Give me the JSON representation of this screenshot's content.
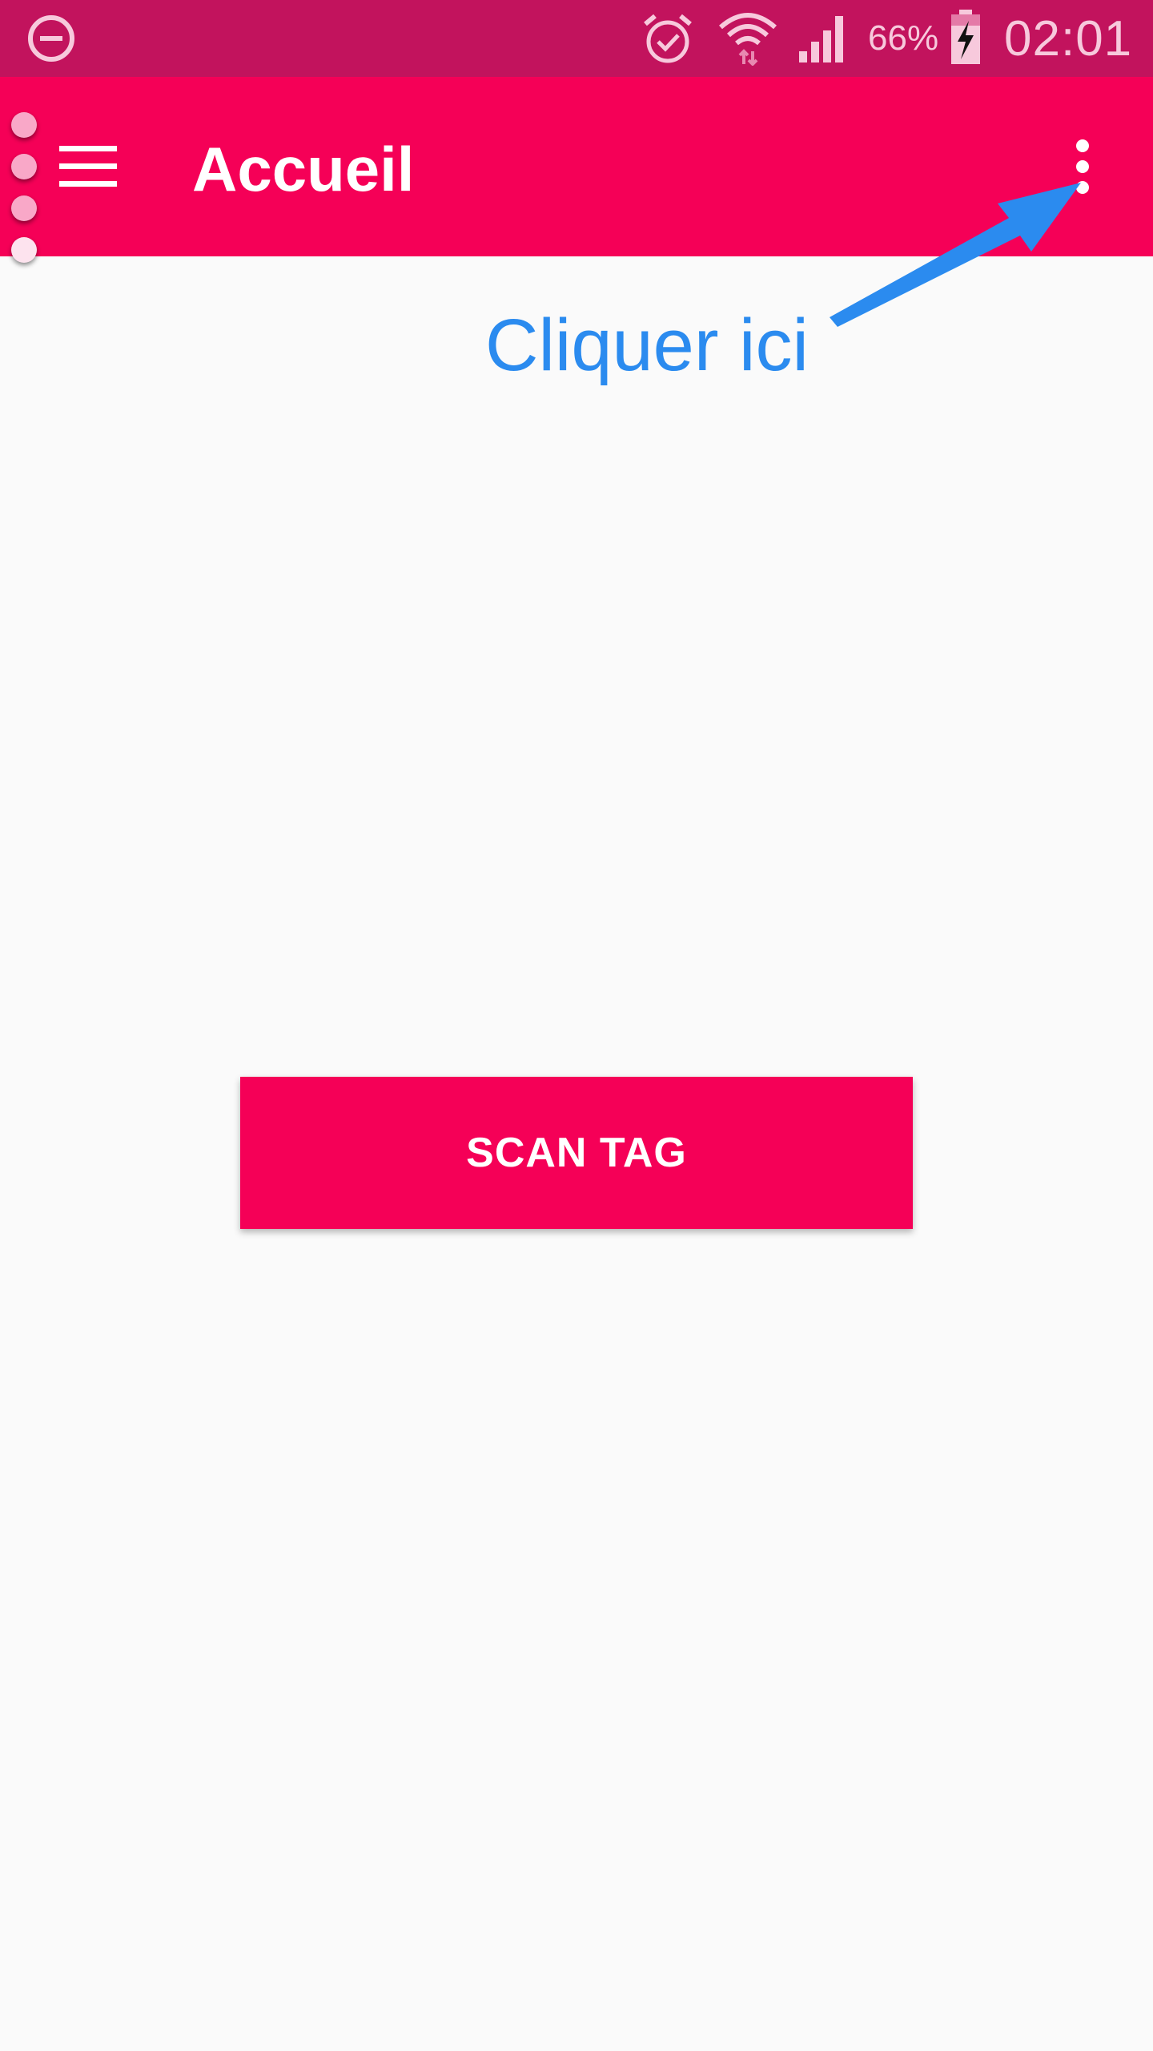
{
  "status_bar": {
    "battery_percent": "66%",
    "time": "02:01",
    "icons": [
      "do-not-disturb-icon",
      "alarm-icon",
      "wifi-icon",
      "signal-icon",
      "battery-charging-icon"
    ]
  },
  "app_bar": {
    "title": "Accueil",
    "menu_icon": "hamburger-menu-icon",
    "overflow_icon": "more-vert-icon"
  },
  "annotation": {
    "text": "Cliquer ici",
    "color": "#2b8bef"
  },
  "main": {
    "scan_button_label": "SCAN TAG"
  },
  "colors": {
    "status_bar": "#c2135d",
    "primary": "#f50057",
    "background": "#fafafa"
  }
}
